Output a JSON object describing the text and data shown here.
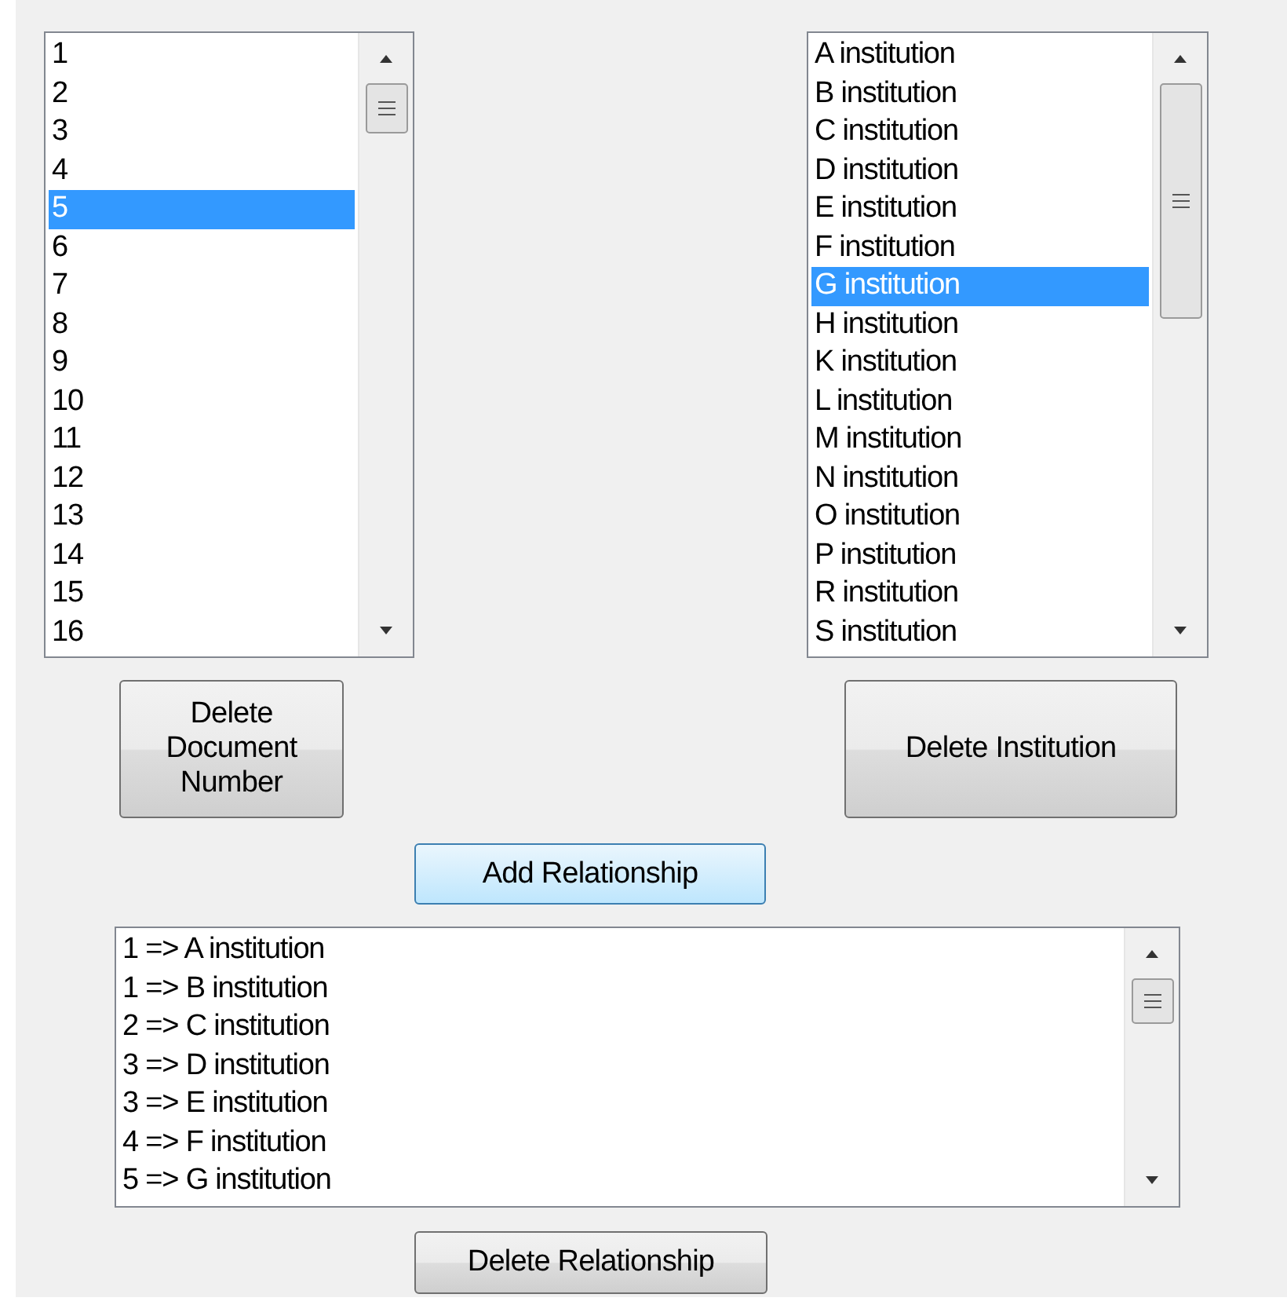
{
  "document_list": {
    "items": [
      {
        "label": "1",
        "selected": false
      },
      {
        "label": "2",
        "selected": false
      },
      {
        "label": "3",
        "selected": false
      },
      {
        "label": "4",
        "selected": false
      },
      {
        "label": "5",
        "selected": true
      },
      {
        "label": "6",
        "selected": false
      },
      {
        "label": "7",
        "selected": false
      },
      {
        "label": "8",
        "selected": false
      },
      {
        "label": "9",
        "selected": false
      },
      {
        "label": "10",
        "selected": false
      },
      {
        "label": "11",
        "selected": false
      },
      {
        "label": "12",
        "selected": false
      },
      {
        "label": "13",
        "selected": false
      },
      {
        "label": "14",
        "selected": false
      },
      {
        "label": "15",
        "selected": false
      },
      {
        "label": "16",
        "selected": false
      }
    ]
  },
  "institution_list": {
    "items": [
      {
        "label": "A institution",
        "selected": false
      },
      {
        "label": "B institution",
        "selected": false
      },
      {
        "label": "C institution",
        "selected": false
      },
      {
        "label": "D institution",
        "selected": false
      },
      {
        "label": "E institution",
        "selected": false
      },
      {
        "label": "F institution",
        "selected": false
      },
      {
        "label": "G institution",
        "selected": true
      },
      {
        "label": "H institution",
        "selected": false
      },
      {
        "label": "K institution",
        "selected": false
      },
      {
        "label": "L institution",
        "selected": false
      },
      {
        "label": "M institution",
        "selected": false
      },
      {
        "label": "N institution",
        "selected": false
      },
      {
        "label": "O institution",
        "selected": false
      },
      {
        "label": "P institution",
        "selected": false
      },
      {
        "label": "R institution",
        "selected": false
      },
      {
        "label": "S institution",
        "selected": false
      }
    ]
  },
  "delete_document_button": "Delete Document Number",
  "delete_institution_button": "Delete Institution",
  "add_relationship_button": "Add Relationship",
  "relationship_list": {
    "items": [
      {
        "label": "1 => A institution",
        "selected": false
      },
      {
        "label": "1 => B institution",
        "selected": false
      },
      {
        "label": "2 => C institution",
        "selected": false
      },
      {
        "label": "3 => D institution",
        "selected": false
      },
      {
        "label": "3 => E institution",
        "selected": false
      },
      {
        "label": "4 => F institution",
        "selected": false
      },
      {
        "label": "5 => G institution",
        "selected": false
      }
    ]
  },
  "delete_relationship_button": "Delete Relationship"
}
